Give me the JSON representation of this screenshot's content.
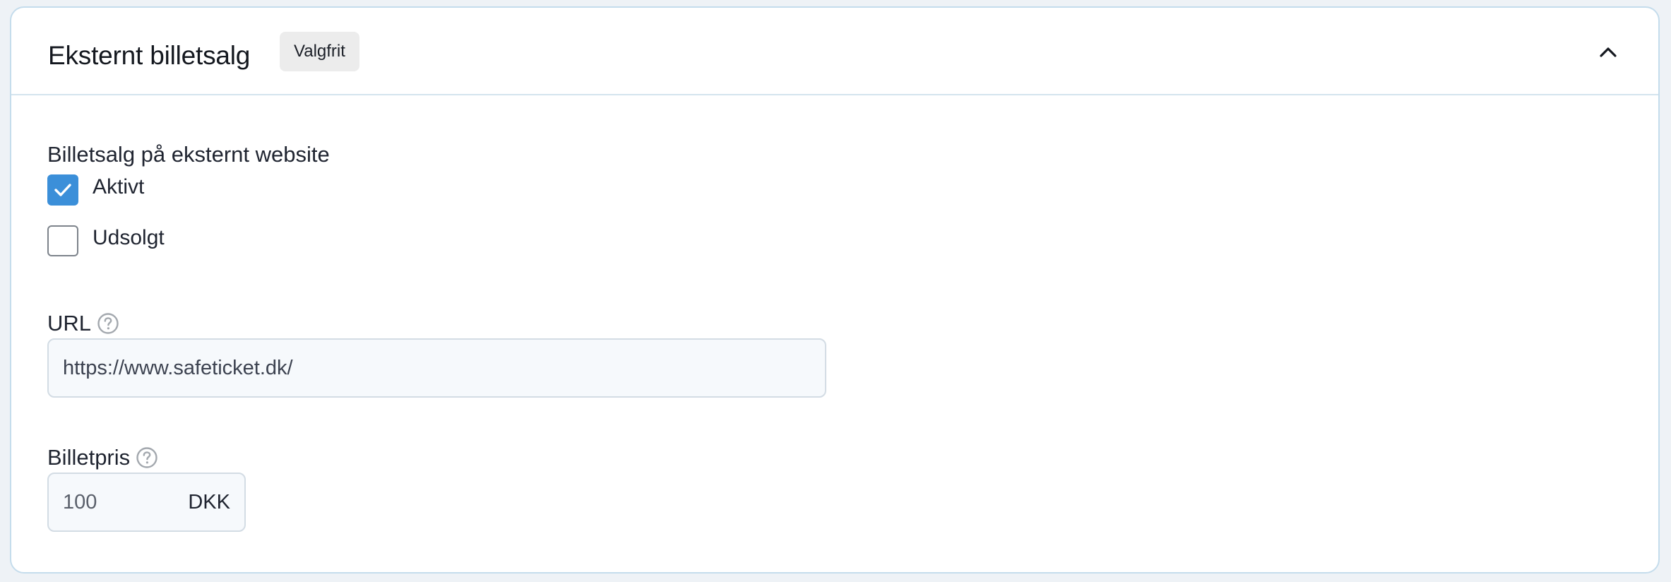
{
  "panel": {
    "title": "Eksternt billetsalg",
    "badge": "Valgfrit",
    "collapse_icon": "chevron-up-icon"
  },
  "external_sales": {
    "section_label": "Billetsalg på eksternt website",
    "options": [
      {
        "label": "Aktivt",
        "checked": true
      },
      {
        "label": "Udsolgt",
        "checked": false
      }
    ]
  },
  "url_field": {
    "label": "URL",
    "help_icon": "question-circle-icon",
    "value": "https://www.safeticket.dk/"
  },
  "price_field": {
    "label": "Billetpris",
    "help_icon": "question-circle-icon",
    "value": "100",
    "suffix": "DKK"
  },
  "colors": {
    "accent": "#3b8fd9",
    "card_border": "#c4dcec",
    "badge_bg": "#ececec",
    "input_bg": "#f6f9fc"
  }
}
